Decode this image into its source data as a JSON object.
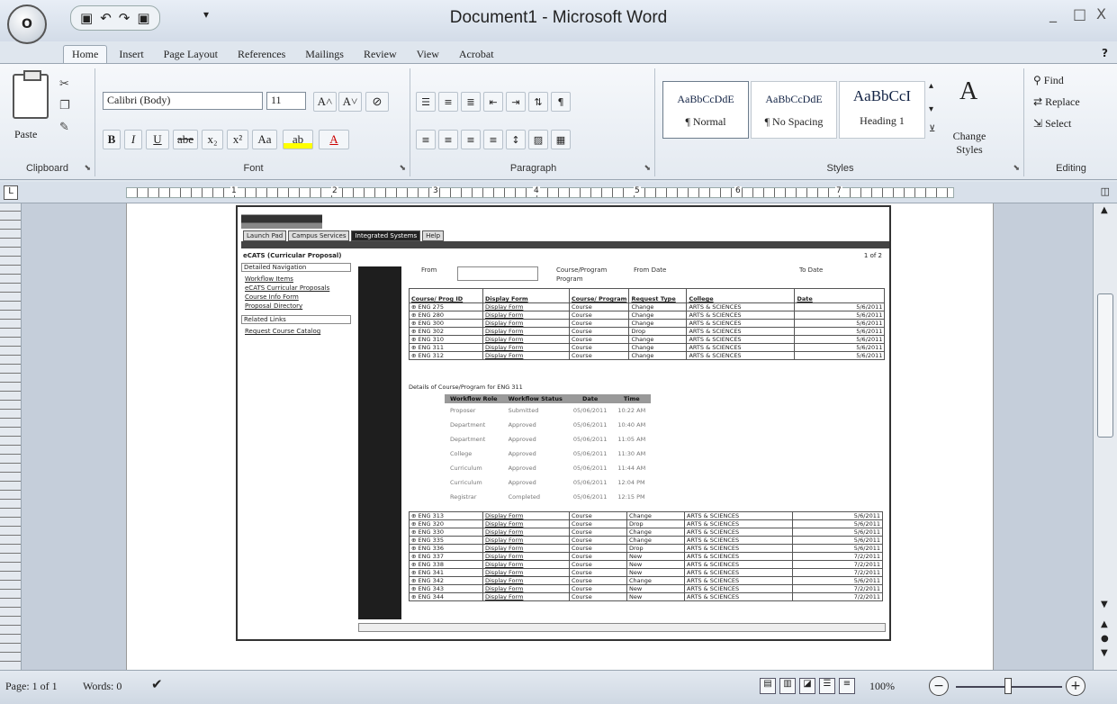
{
  "window": {
    "title": "Document1 - Microsoft Word",
    "office_button_label": "O",
    "controls": [
      "_",
      "□",
      "X"
    ]
  },
  "quick_access": {
    "save": "💾",
    "undo": "↶",
    "redo": "↷",
    "print": "▣",
    "dropdown": "▾"
  },
  "tabs": [
    "Home",
    "Insert",
    "Page Layout",
    "References",
    "Mailings",
    "Review",
    "View",
    "Acrobat"
  ],
  "ribbon": {
    "clipboard": {
      "paste_label": "Paste",
      "group_label": "Clipboard"
    },
    "font": {
      "font_name": "Calibri (Body)",
      "font_size": "11",
      "grow": "A˄",
      "shrink": "A˅",
      "clear": "⊘",
      "bold": "B",
      "italic": "I",
      "underline": "U",
      "strike": "abe",
      "subscript": "x₂",
      "superscript": "x²",
      "change_case": "Aa",
      "highlight": "ab",
      "font_color": "A",
      "group_label": "Font"
    },
    "paragraph": {
      "row1": [
        "☰",
        "≡",
        "≣",
        "⇤",
        "⇥",
        "⇅",
        "¶"
      ],
      "row2": [
        "≡",
        "≡",
        "≡",
        "≡",
        "↕",
        "▨",
        "▦"
      ],
      "group_label": "Paragraph"
    },
    "styles": {
      "items": [
        {
          "sample": "AaBbCcDdE",
          "name": "¶ Normal"
        },
        {
          "sample": "AaBbCcDdE",
          "name": "¶ No Spacing"
        },
        {
          "sample": "AaBbCcI",
          "name": "Heading 1"
        }
      ],
      "change_styles_label": "Change Styles",
      "group_label": "Styles"
    },
    "editing": {
      "find": "Find",
      "replace": "Replace",
      "select": "Select",
      "group_label": "Editing"
    }
  },
  "ruler": {
    "numbers": [
      "1",
      "2",
      "3",
      "4",
      "5",
      "6",
      "7"
    ]
  },
  "embedded": {
    "nav": [
      "Launch Pad",
      "Campus Services",
      "Integrated Systems",
      "Help"
    ],
    "left_title": "eCATS (Curricular Proposal)",
    "left_boxes": [
      "Detailed Navigation",
      "",
      "",
      ""
    ],
    "left_links": [
      "Workflow Items",
      "eCATS Curricular Proposals",
      "Course Info Form",
      "Proposal Directory"
    ],
    "left_section": "Related Links",
    "left_section_link": "Request Course Catalog",
    "page_info": "1 of 2",
    "filters": [
      "From",
      "Course/Program",
      "Program",
      "From Date",
      "To Date"
    ],
    "table_headers": [
      "Course/ Prog ID",
      "Display Form",
      "Course/ Program",
      "Request Type",
      "College",
      "Date"
    ],
    "rows_top": [
      [
        "ENG 275",
        "Display Form",
        "Course",
        "Change",
        "ARTS & SCIENCES",
        "5/6/2011"
      ],
      [
        "ENG 280",
        "Display Form",
        "Course",
        "Change",
        "ARTS & SCIENCES",
        "5/6/2011"
      ],
      [
        "ENG 300",
        "Display Form",
        "Course",
        "Change",
        "ARTS & SCIENCES",
        "5/6/2011"
      ],
      [
        "ENG 302",
        "Display Form",
        "Course",
        "Drop",
        "ARTS & SCIENCES",
        "5/6/2011"
      ],
      [
        "ENG 310",
        "Display Form",
        "Course",
        "Change",
        "ARTS & SCIENCES",
        "5/6/2011"
      ],
      [
        "ENG 311",
        "Display Form",
        "Course",
        "Change",
        "ARTS & SCIENCES",
        "5/6/2011"
      ],
      [
        "ENG 312",
        "Display Form",
        "Course",
        "Change",
        "ARTS & SCIENCES",
        "5/6/2011"
      ]
    ],
    "history_title": "Details of Course/Program for ENG 311",
    "history_headers": [
      "Workflow Role",
      "Workflow Status",
      "Date",
      "Time"
    ],
    "history_rows": [
      [
        "Proposer",
        "Submitted",
        "05/06/2011",
        "10:22 AM"
      ],
      [
        "Department",
        "Approved",
        "05/06/2011",
        "10:40 AM"
      ],
      [
        "Department",
        "Approved",
        "05/06/2011",
        "11:05 AM"
      ],
      [
        "College",
        "Approved",
        "05/06/2011",
        "11:30 AM"
      ],
      [
        "Curriculum",
        "Approved",
        "05/06/2011",
        "11:44 AM"
      ],
      [
        "Curriculum",
        "Approved",
        "05/06/2011",
        "12:04 PM"
      ],
      [
        "Registrar",
        "Completed",
        "05/06/2011",
        "12:15 PM"
      ]
    ],
    "rows_bottom": [
      [
        "ENG 313",
        "Display Form",
        "Course",
        "Change",
        "ARTS & SCIENCES",
        "5/6/2011"
      ],
      [
        "ENG 320",
        "Display Form",
        "Course",
        "Drop",
        "ARTS & SCIENCES",
        "5/6/2011"
      ],
      [
        "ENG 330",
        "Display Form",
        "Course",
        "Change",
        "ARTS & SCIENCES",
        "5/6/2011"
      ],
      [
        "ENG 335",
        "Display Form",
        "Course",
        "Change",
        "ARTS & SCIENCES",
        "5/6/2011"
      ],
      [
        "ENG 336",
        "Display Form",
        "Course",
        "Drop",
        "ARTS & SCIENCES",
        "5/6/2011"
      ],
      [
        "ENG 337",
        "Display Form",
        "Course",
        "New",
        "ARTS & SCIENCES",
        "7/2/2011"
      ],
      [
        "ENG 338",
        "Display Form",
        "Course",
        "New",
        "ARTS & SCIENCES",
        "7/2/2011"
      ],
      [
        "ENG 341",
        "Display Form",
        "Course",
        "New",
        "ARTS & SCIENCES",
        "7/2/2011"
      ],
      [
        "ENG 342",
        "Display Form",
        "Course",
        "Change",
        "ARTS & SCIENCES",
        "5/6/2011"
      ],
      [
        "ENG 343",
        "Display Form",
        "Course",
        "New",
        "ARTS & SCIENCES",
        "7/2/2011"
      ],
      [
        "ENG 344",
        "Display Form",
        "Course",
        "New",
        "ARTS & SCIENCES",
        "7/2/2011"
      ]
    ]
  },
  "status": {
    "page": "Page: 1 of 1",
    "words": "Words: 0",
    "zoom": "100%",
    "zoom_minus": "−",
    "zoom_plus": "+"
  }
}
